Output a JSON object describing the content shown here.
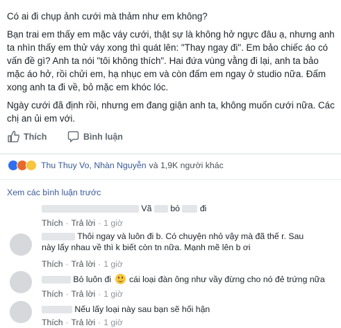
{
  "post": {
    "paragraphs": [
      "Có ai đi chụp ảnh cưới mà thảm như em không?",
      "Bạn trai em thấy em mặc váy cưới, thật sự là không hở ngực đâu ạ, nhưng anh ta nhìn thấy em thử váy xong thì quát lên: \"Thay ngay đi\". Em bảo chiếc áo có vấn đề gì? Anh ta nói \"tôi không thích\". Hai đứa vùng vằng đi lại, anh ta bảo mặc áo hở, rồi chửi em, hạ nhục em và còn đấm em ngay ở studio nữa. Đấm xong anh ta đi về, bỏ mặc em khóc lóc.",
      "Ngày cưới đã định rồi, nhưng em đang giận anh ta, không muốn cưới nữa. Các chị an ủi em với."
    ]
  },
  "actions": {
    "like": {
      "label": "Thích",
      "icon": "thumbs-up-icon"
    },
    "comment": {
      "label": "Bình luận",
      "icon": "comment-icon"
    }
  },
  "reactions": {
    "icons": [
      "like",
      "angry",
      "wow"
    ],
    "names": "Thu Thuy Vo, Nhàn Nguyễn",
    "others": "và 1,9K người khác",
    "colors": {
      "like": "#2f6fed",
      "angry": "#e86a2a",
      "wow": "#f7c53e"
    }
  },
  "view_previous": "Xem các bình luận trước",
  "comments": [
    {
      "text_a": "Vã",
      "text_b": "bỏ",
      "text_c": "đi",
      "like": "Thích",
      "reply": "Trả lời",
      "time": "1 giờ"
    },
    {
      "text": "Thôi ngay và luôn đi b. Có chuyện nhỏ vậy mà đã thế r. Sau này lấy nhau về thì k biết còn tn nữa. Mạnh mẽ lên b ơi",
      "like": "Thích",
      "reply": "Trả lời",
      "time": "1 giờ"
    },
    {
      "text_a": "Bỏ luôn đi",
      "text_b": "cái loại đàn ông như vầy đừng cho nó đẻ trứng nữa",
      "emoji": "smile-emoji",
      "like": "Thích",
      "reply": "Trả lời",
      "time": "1 giờ"
    },
    {
      "text": "Nếu lấy loại này sau bạn sẽ hối hận",
      "like": "Thích",
      "reply": "Trả lời",
      "time": "1 giờ"
    }
  ]
}
